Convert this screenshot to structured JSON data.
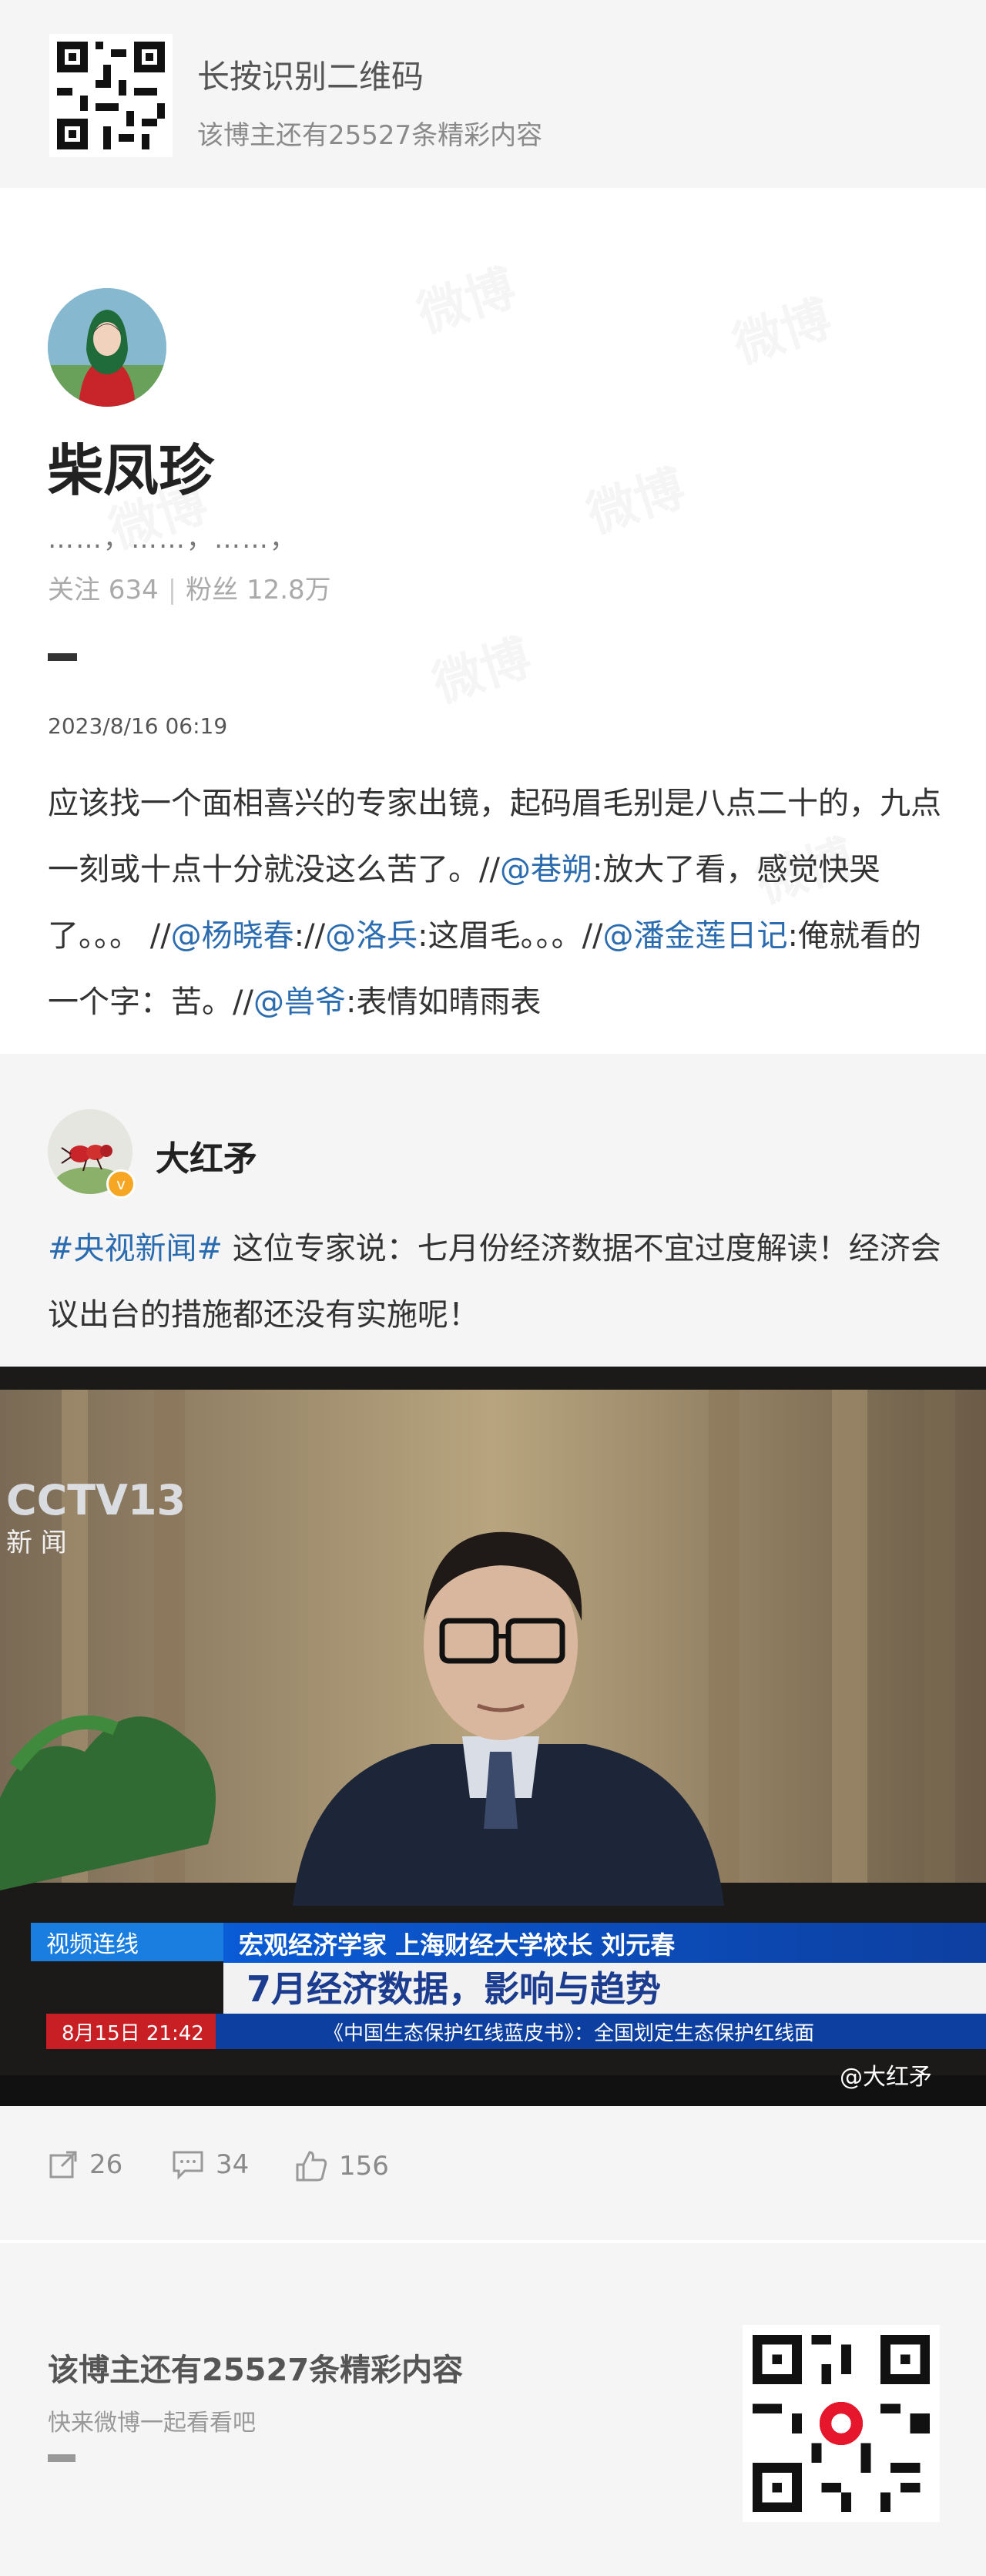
{
  "header": {
    "title": "长按识别二维码",
    "subtitle": "该博主还有25527条精彩内容"
  },
  "profile": {
    "name": "柴凤珍",
    "bio": "……，……，……，",
    "stats_follow": "关注 634",
    "stats_fans": "粉丝 12.8万"
  },
  "post": {
    "date": "2023/8/16 06:19",
    "segments": [
      {
        "t": "应该找一个面相喜兴的专家出镜，起码眉毛别是八点二十的，九点一刻或十点十分就没这么苦了。//"
      },
      {
        "t": "@巷朔",
        "m": true
      },
      {
        "t": ":放大了看，感觉快哭了。。。 //"
      },
      {
        "t": "@杨晓春",
        "m": true
      },
      {
        "t": "://"
      },
      {
        "t": "@洛兵",
        "m": true
      },
      {
        "t": ":这眉毛。。。//"
      },
      {
        "t": "@潘金莲日记",
        "m": true
      },
      {
        "t": ":俺就看的一个字：苦。//"
      },
      {
        "t": "@兽爷",
        "m": true
      },
      {
        "t": ":表情如晴雨表"
      }
    ]
  },
  "repost": {
    "name": "大红矛",
    "topic": "#央视新闻#",
    "text": " 这位专家说：七月份经济数据不宜过度解读！经济会议出台的措施都还没有实施呢！",
    "video": {
      "channel_logo": "CCTV13",
      "channel_name": "新 闻",
      "lower_tag": "视频连线",
      "name_bar": "宏观经济学家 上海财经大学校长 刘元春",
      "headline": "7月经济数据，影响与趋势",
      "ticker": "《中国生态保护红线蓝皮书》：全国划定生态保护红线面",
      "date_time": "8月15日 21:42",
      "watermark": "@大红矛"
    }
  },
  "actions": {
    "share": "26",
    "comment": "34",
    "like": "156"
  },
  "footer": {
    "title": "该博主还有25527条精彩内容",
    "subtitle": "快来微博一起看看吧"
  }
}
